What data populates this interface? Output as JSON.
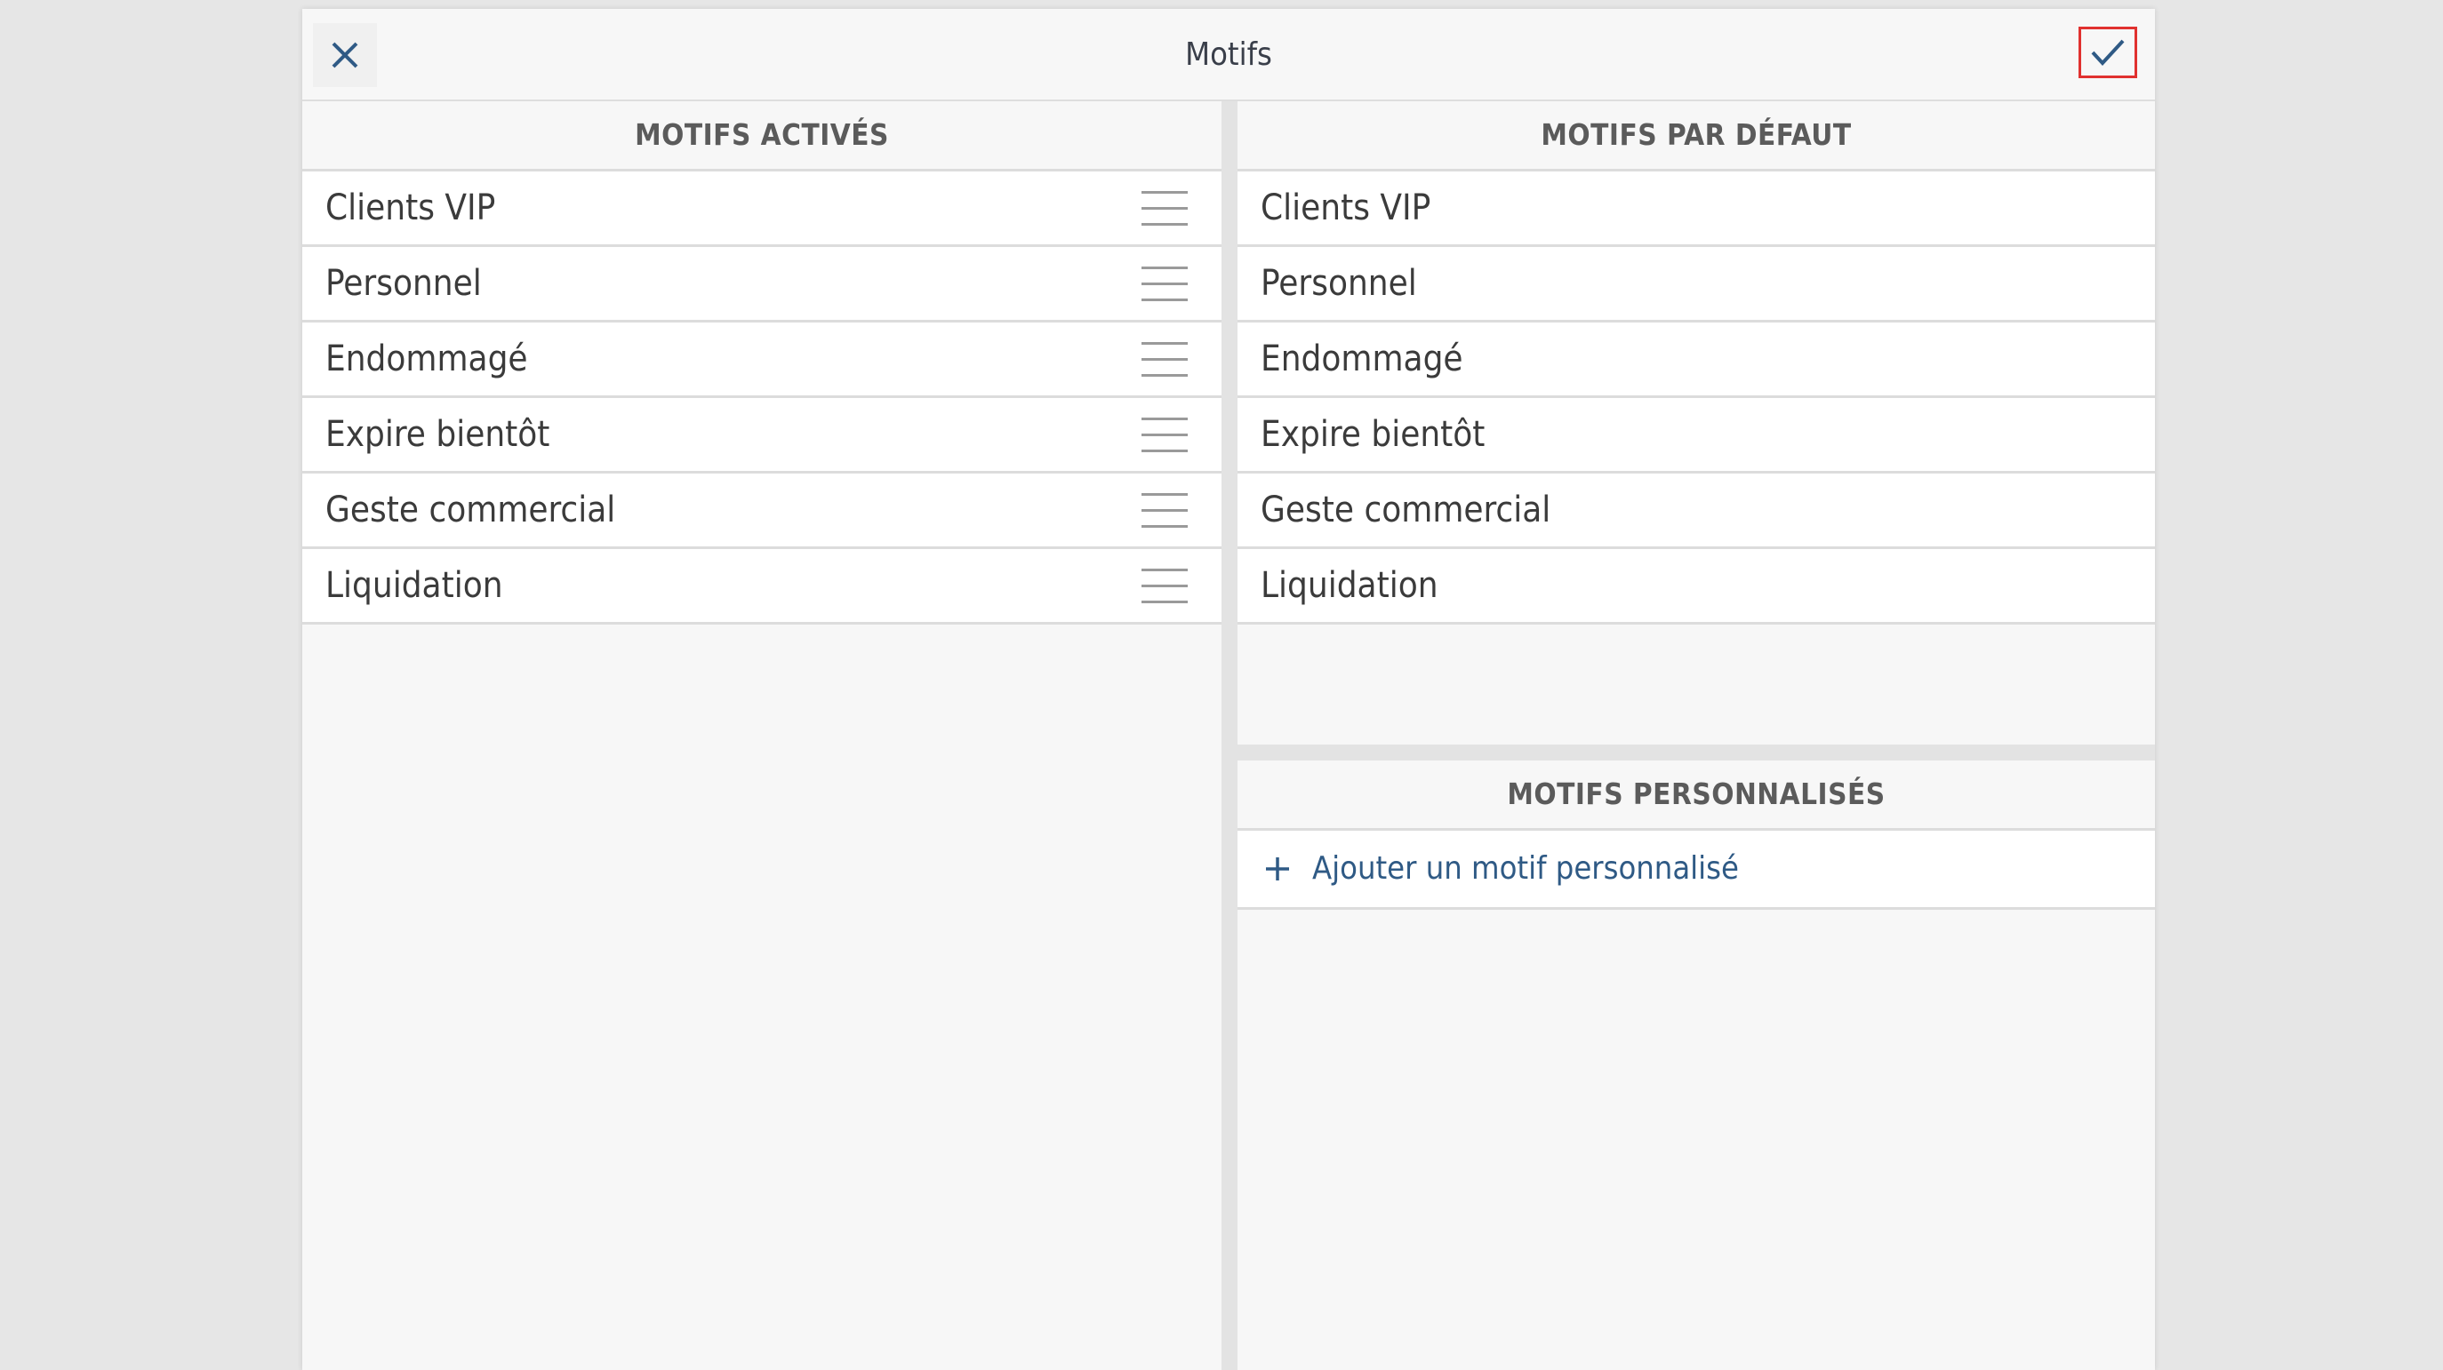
{
  "header": {
    "title": "Motifs",
    "close_icon": "close-icon",
    "confirm_icon": "checkmark-icon"
  },
  "active": {
    "title": "MOTIFS ACTIVÉS",
    "items": [
      {
        "label": "Clients VIP"
      },
      {
        "label": "Personnel"
      },
      {
        "label": "Endommagé"
      },
      {
        "label": "Expire bientôt"
      },
      {
        "label": "Geste commercial"
      },
      {
        "label": "Liquidation"
      }
    ]
  },
  "defaults": {
    "title": "MOTIFS PAR DÉFAUT",
    "items": [
      {
        "label": "Clients VIP"
      },
      {
        "label": "Personnel"
      },
      {
        "label": "Endommagé"
      },
      {
        "label": "Expire bientôt"
      },
      {
        "label": "Geste commercial"
      },
      {
        "label": "Liquidation"
      }
    ]
  },
  "custom": {
    "title": "MOTIFS PERSONNALISÉS",
    "add_label": "Ajouter un motif personnalisé"
  },
  "colors": {
    "accent": "#2f5a85",
    "highlight_border": "#e0312f"
  }
}
